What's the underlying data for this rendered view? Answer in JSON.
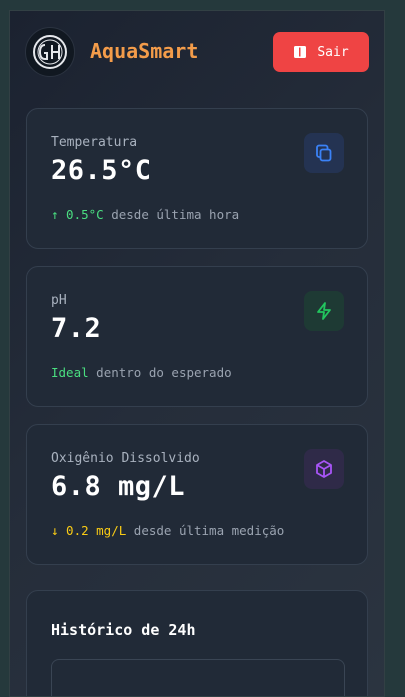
{
  "header": {
    "logo_alt": "GH",
    "brand": "AquaSmart",
    "logout_label": "Sair"
  },
  "metrics": [
    {
      "label": "Temperatura",
      "value": "26.5°C",
      "trend_highlight": "↑ 0.5°C",
      "trend_text": "desde última hora",
      "trend_color": "#4ade80",
      "icon": "copy-icon",
      "icon_color": "#3b82f6"
    },
    {
      "label": "pH",
      "value": "7.2",
      "trend_highlight": "Ideal",
      "trend_text": "dentro do esperado",
      "trend_color": "#4ade80",
      "icon": "lightning-icon",
      "icon_color": "#22c55e"
    },
    {
      "label": "Oxigênio Dissolvido",
      "value": "6.8 mg/L",
      "trend_highlight": "↓ 0.2 mg/L",
      "trend_text": "desde última medição",
      "trend_color": "#facc15",
      "icon": "cube-icon",
      "icon_color": "#a855f7"
    }
  ],
  "history": {
    "title": "Histórico de 24h"
  },
  "colors": {
    "accent": "#f39c4a",
    "danger": "#ef4444"
  }
}
